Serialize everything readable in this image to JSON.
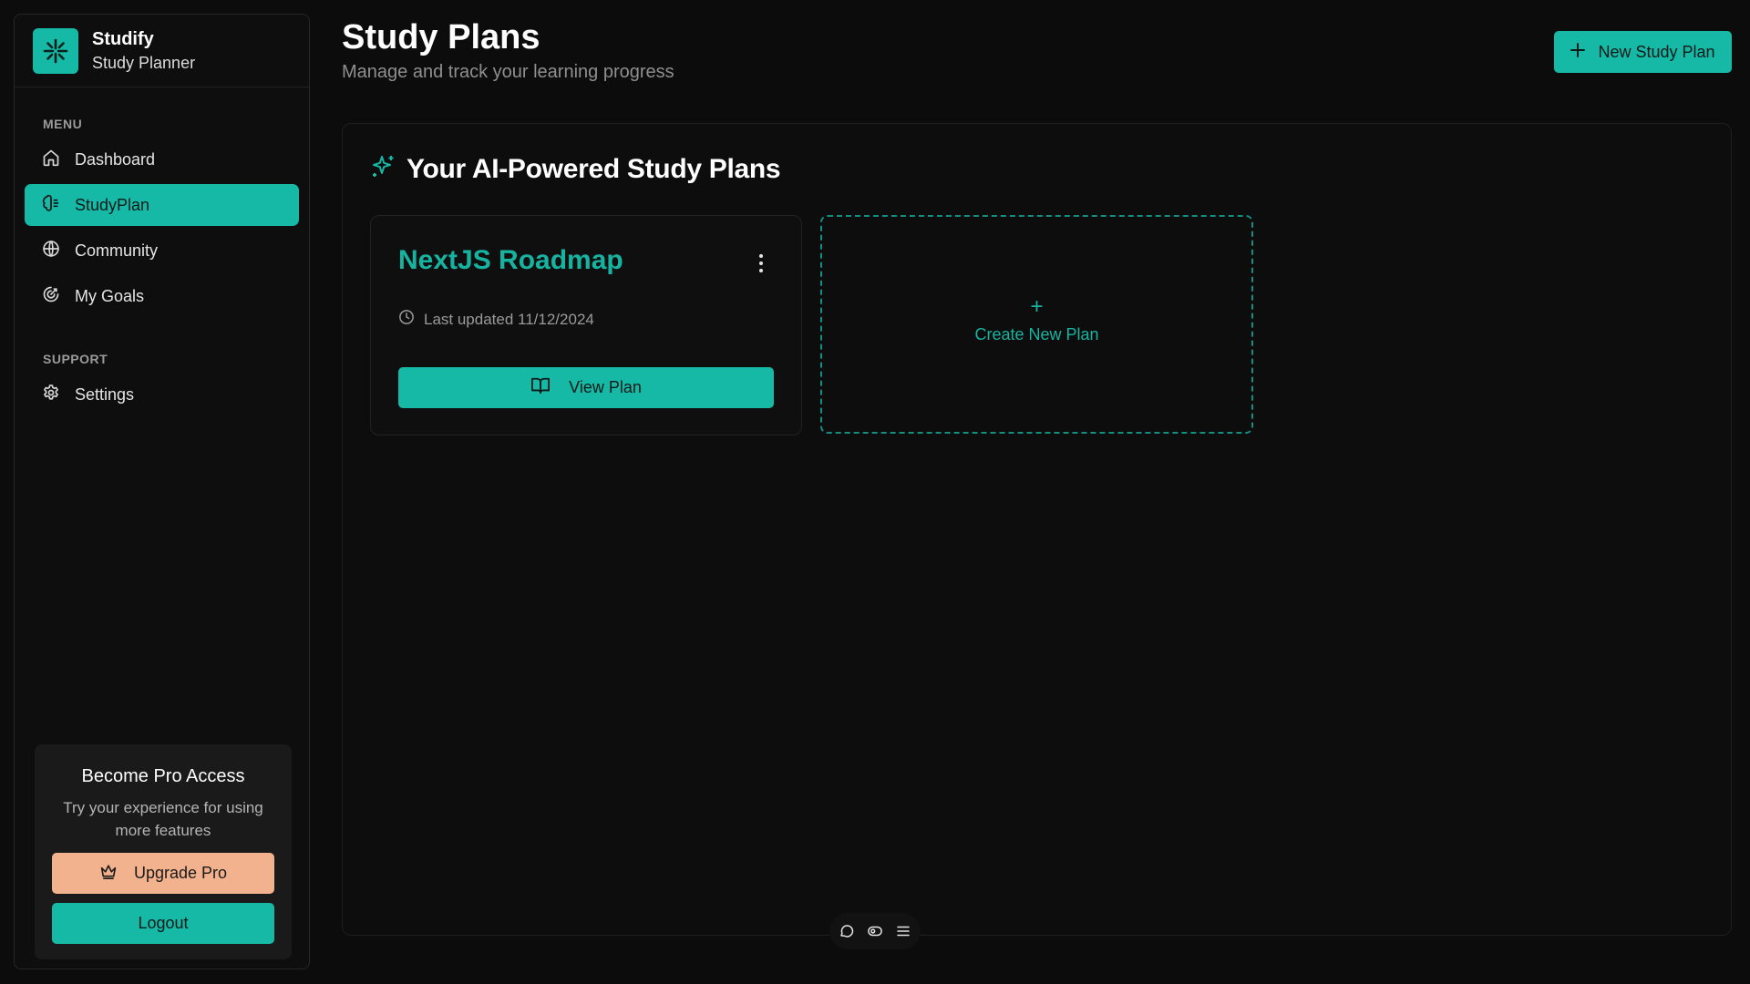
{
  "brand": {
    "name": "Studify",
    "subtitle": "Study Planner",
    "logo_icon": "asterisk-icon",
    "accent": "#16b8a6"
  },
  "sidebar": {
    "menu_title": "MENU",
    "menu_items": [
      {
        "label": "Dashboard",
        "icon": "home-icon",
        "active": false
      },
      {
        "label": "StudyPlan",
        "icon": "brain-icon",
        "active": true
      },
      {
        "label": "Community",
        "icon": "globe-icon",
        "active": false
      },
      {
        "label": "My Goals",
        "icon": "target-icon",
        "active": false
      }
    ],
    "support_title": "SUPPORT",
    "support_items": [
      {
        "label": "Settings",
        "icon": "gear-icon"
      }
    ],
    "pro": {
      "title": "Become Pro Access",
      "description": "Try your experience for using more features",
      "upgrade_label": "Upgrade Pro",
      "logout_label": "Logout",
      "upgrade_color": "#f2b28e"
    }
  },
  "header": {
    "title": "Study Plans",
    "subtitle": "Manage and track your learning progress",
    "new_button_label": "New Study Plan"
  },
  "panel": {
    "title": "Your AI-Powered Study Plans",
    "plans": [
      {
        "name": "NextJS Roadmap",
        "updated": "Last updated 11/12/2024",
        "action_label": "View Plan"
      }
    ],
    "create_plus": "+",
    "create_label": "Create New Plan"
  },
  "toolbar": {
    "icons": [
      "comment-icon",
      "eye-icon",
      "menu-icon"
    ]
  }
}
